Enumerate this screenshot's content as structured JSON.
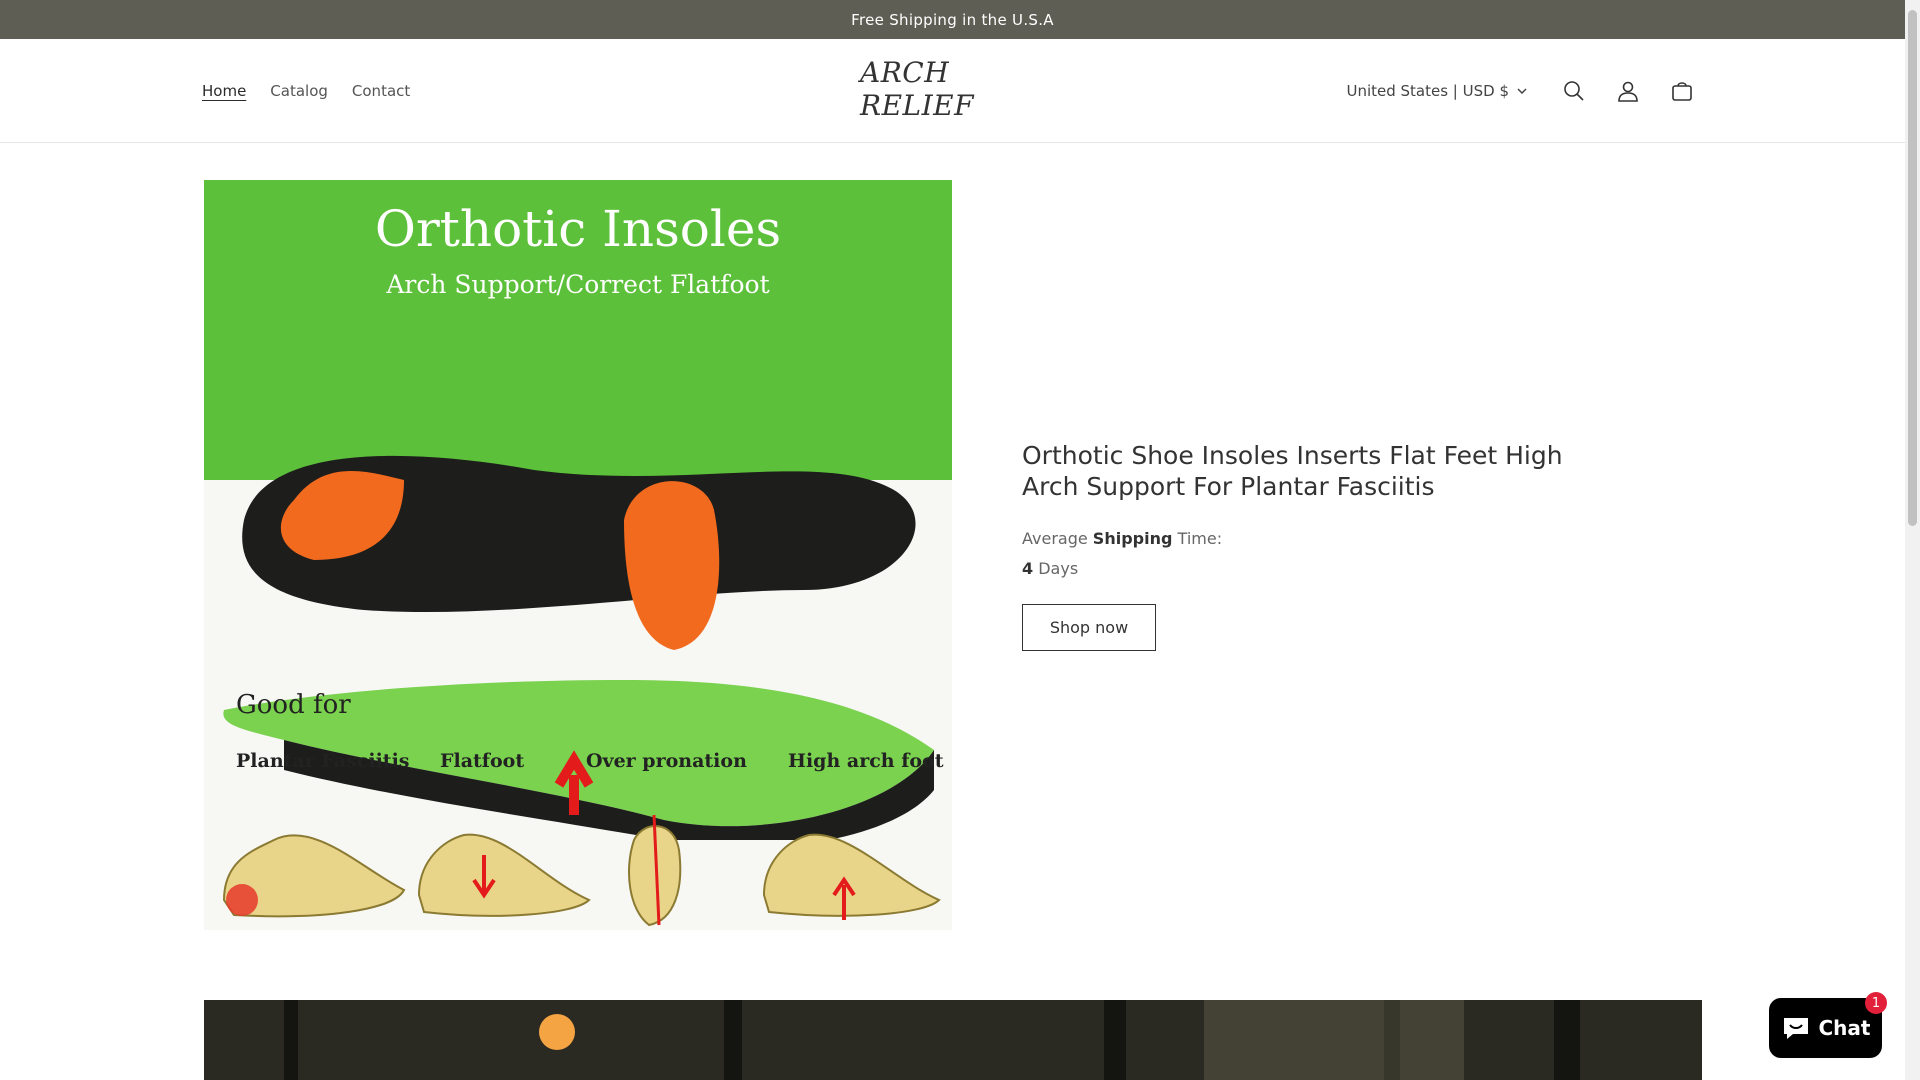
{
  "announcement": "Free Shipping in the U.S.A",
  "header": {
    "nav": [
      {
        "label": "Home",
        "active": true
      },
      {
        "label": "Catalog",
        "active": false
      },
      {
        "label": "Contact",
        "active": false
      }
    ],
    "logo": "ARCH RELIEF",
    "country_selector": "United States | USD $",
    "icons": [
      "search-icon",
      "account-icon",
      "cart-icon"
    ]
  },
  "product_image": {
    "title": "Orthotic Insoles",
    "subtitle": "Arch Support/Correct Flatfoot",
    "good_for": "Good for",
    "conditions": [
      "Plantar Fasciitis",
      "Flatfoot",
      "Over pronation",
      "High arch foot"
    ]
  },
  "product": {
    "title": "Orthotic Shoe Insoles Inserts Flat Feet High Arch Support For Plantar Fasciitis",
    "shipping_prefix": "Average",
    "shipping_bold": "Shipping",
    "shipping_suffix": "Time:",
    "days_num": "4",
    "days_label": "Days",
    "button": "Shop now"
  },
  "chat": {
    "label": "Chat",
    "badge": "1"
  },
  "colors": {
    "announcement_bg": "#5e5e55",
    "image_green": "#5cc03a",
    "chat_bg": "#000000",
    "badge": "#e2203a"
  }
}
